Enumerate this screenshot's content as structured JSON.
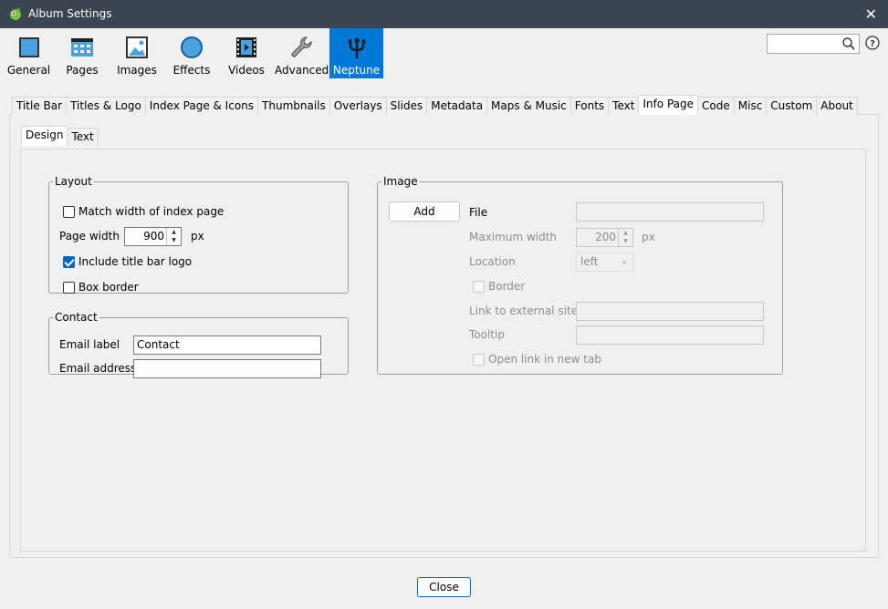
{
  "window": {
    "title": "Album Settings",
    "close_glyph": "✕"
  },
  "toolbar": {
    "items": [
      {
        "label": "General",
        "icon": "general-icon"
      },
      {
        "label": "Pages",
        "icon": "pages-icon"
      },
      {
        "label": "Images",
        "icon": "images-icon"
      },
      {
        "label": "Effects",
        "icon": "effects-icon"
      },
      {
        "label": "Videos",
        "icon": "videos-icon"
      },
      {
        "label": "Advanced",
        "icon": "wrench-icon"
      },
      {
        "label": "Neptune",
        "icon": "trident-icon",
        "active": true
      }
    ],
    "search_placeholder": ""
  },
  "tabs": [
    "Title Bar",
    "Titles & Logo",
    "Index Page & Icons",
    "Thumbnails",
    "Overlays",
    "Slides",
    "Metadata",
    "Maps & Music",
    "Fonts",
    "Text",
    "Info Page",
    "Code",
    "Misc",
    "Custom",
    "About"
  ],
  "selected_tab": "Info Page",
  "subtabs": [
    "Design",
    "Text"
  ],
  "selected_subtab": "Design",
  "layout": {
    "legend": "Layout",
    "match_width_label": "Match width of index page",
    "match_width_checked": false,
    "page_width_label": "Page width",
    "page_width_value": "900",
    "page_width_unit": "px",
    "include_logo_label": "Include title bar logo",
    "include_logo_checked": true,
    "box_border_label": "Box border",
    "box_border_checked": false
  },
  "contact": {
    "legend": "Contact",
    "email_label_label": "Email label",
    "email_label_value": "Contact",
    "email_address_label": "Email address",
    "email_address_value": ""
  },
  "image": {
    "legend": "Image",
    "add_button": "Add",
    "file_label": "File",
    "file_value": "",
    "max_width_label": "Maximum width",
    "max_width_value": "200",
    "max_width_unit": "px",
    "location_label": "Location",
    "location_value": "left",
    "border_label": "Border",
    "link_label": "Link to external site",
    "link_value": "",
    "tooltip_label": "Tooltip",
    "tooltip_value": "",
    "open_new_tab_label": "Open link in new tab"
  },
  "footer": {
    "close_button": "Close"
  },
  "colors": {
    "titlebar": "#3b4451",
    "accent": "#0078d7",
    "checkbox": "#0067c0"
  }
}
